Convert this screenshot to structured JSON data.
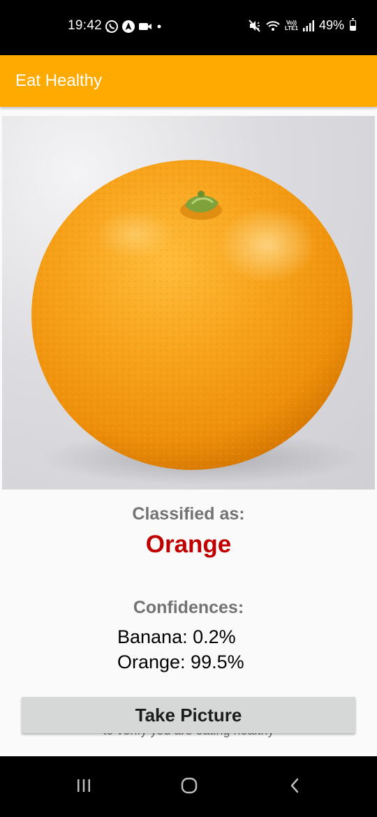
{
  "status_bar": {
    "time": "19:42",
    "left_icons": [
      "whatsapp-icon",
      "navigation-icon",
      "video-camera-icon",
      "notification-dot-icon"
    ],
    "right_icons": [
      "mute-icon",
      "wifi-icon",
      "volte-icon",
      "signal-icon"
    ],
    "volte_top": "Vo))",
    "volte_bottom": "LTE1",
    "battery_percent": "49%",
    "battery_level": 0.49
  },
  "app_bar": {
    "title": "Eat Healthy",
    "color": "#ffaa00"
  },
  "result": {
    "image_subject": "orange",
    "classified_label": "Classified as:",
    "classified_value": "Orange",
    "classified_color": "#c00000",
    "confidences_label": "Confidences:",
    "confidences": [
      {
        "text": "Banana: 0.2%"
      },
      {
        "text": "Orange: 99.5%"
      }
    ]
  },
  "actions": {
    "take_picture_label": "Take Picture",
    "hint": "to verify you are eating healthy"
  },
  "nav_bar": {
    "icons": [
      "recents-icon",
      "home-icon",
      "back-icon"
    ]
  }
}
